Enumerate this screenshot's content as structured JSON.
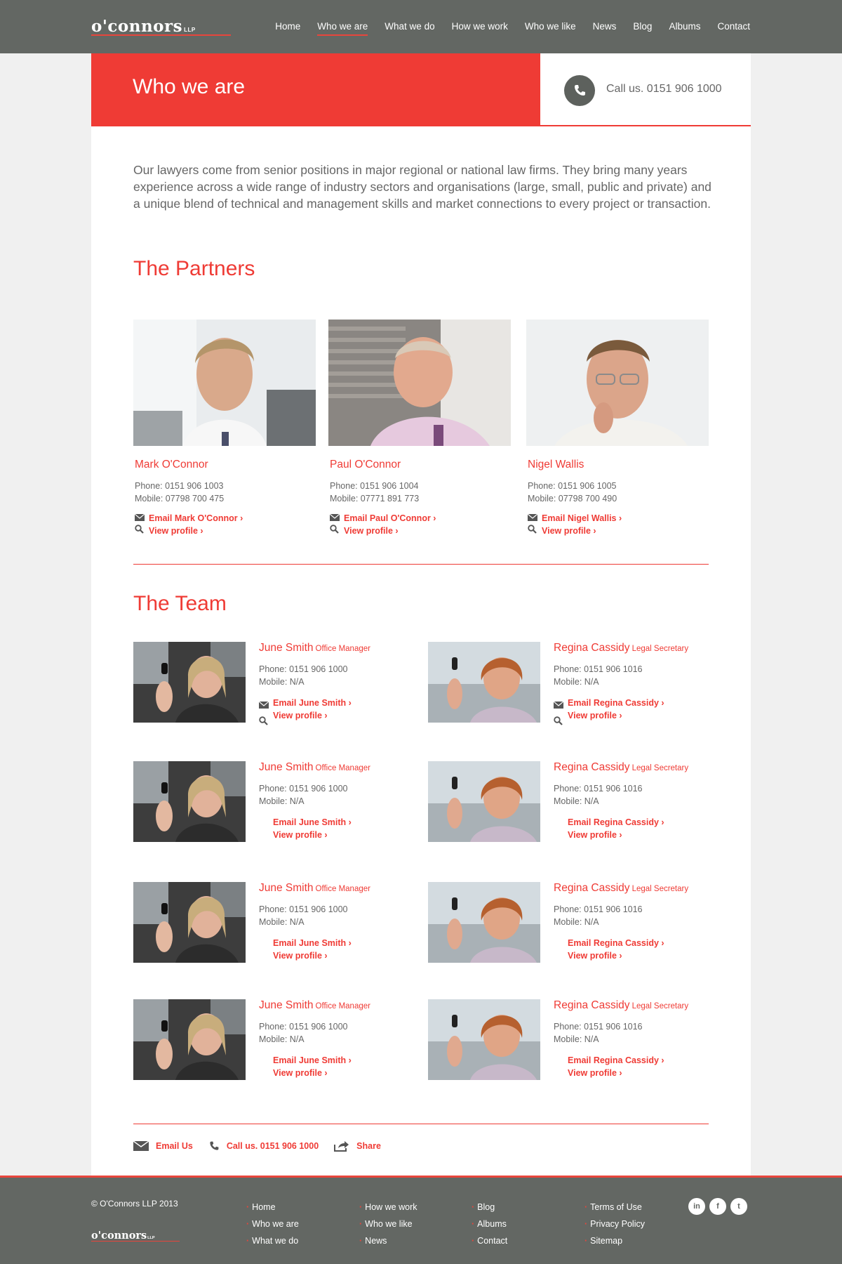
{
  "header": {
    "logo": "o'connors",
    "logo_suffix": "LLP",
    "nav": [
      "Home",
      "Who we are",
      "What we do",
      "How we work",
      "Who we like",
      "News",
      "Blog",
      "Albums",
      "Contact"
    ],
    "active_nav": "Who we are"
  },
  "hero": {
    "title": "Who we are",
    "call": "Call us. 0151 906 1000"
  },
  "intro": "Our lawyers come from senior positions in major regional or national law firms. They bring many years experience across a wide range of industry sectors and organisations (large, small, public and private) and a unique blend of technical and management skills and market connections to every project or transaction.",
  "partners_title": "The Partners",
  "partners": [
    {
      "name": "Mark O'Connor",
      "phone": "Phone: 0151 906 1003",
      "mobile": "Mobile: 07798 700 475",
      "email": "Email Mark O'Connor ›",
      "profile": "View profile ›"
    },
    {
      "name": "Paul O'Connor",
      "phone": "Phone: 0151 906 1004",
      "mobile": "Mobile: 07771 891 773",
      "email": "Email Paul O'Connor ›",
      "profile": "View profile ›"
    },
    {
      "name": "Nigel Wallis",
      "phone": "Phone: 0151 906 1005",
      "mobile": "Mobile: 07798 700 490",
      "email": "Email Nigel Wallis ›",
      "profile": "View profile ›"
    }
  ],
  "team_title": "The Team",
  "team": [
    {
      "name": "June Smith",
      "role": "Office Manager",
      "phone": "Phone: 0151 906 1000",
      "mobile": "Mobile: N/A",
      "email": "Email June Smith ›",
      "profile": "View profile ›"
    },
    {
      "name": "Regina Cassidy",
      "role": "Legal Secretary",
      "phone": "Phone: 0151 906 1016",
      "mobile": "Mobile: N/A",
      "email": "Email Regina Cassidy ›",
      "profile": "View profile ›"
    },
    {
      "name": "June Smith",
      "role": "Office Manager",
      "phone": "Phone: 0151 906 1000",
      "mobile": "Mobile: N/A",
      "email": "Email June Smith ›",
      "profile": "View profile ›"
    },
    {
      "name": "Regina Cassidy",
      "role": "Legal Secretary",
      "phone": "Phone: 0151 906 1016",
      "mobile": "Mobile: N/A",
      "email": "Email Regina Cassidy ›",
      "profile": "View profile ›"
    },
    {
      "name": "June Smith",
      "role": "Office Manager",
      "phone": "Phone: 0151 906 1000",
      "mobile": "Mobile: N/A",
      "email": "Email June Smith ›",
      "profile": "View profile ›"
    },
    {
      "name": "Regina Cassidy",
      "role": "Legal Secretary",
      "phone": "Phone: 0151 906 1016",
      "mobile": "Mobile: N/A",
      "email": "Email Regina Cassidy ›",
      "profile": "View profile ›"
    },
    {
      "name": "June Smith",
      "role": "Office Manager",
      "phone": "Phone: 0151 906 1000",
      "mobile": "Mobile: N/A",
      "email": "Email June Smith ›",
      "profile": "View profile ›"
    },
    {
      "name": "Regina Cassidy",
      "role": "Legal Secretary",
      "phone": "Phone: 0151 906 1016",
      "mobile": "Mobile: N/A",
      "email": "Email Regina Cassidy ›",
      "profile": "View profile ›"
    }
  ],
  "actions": {
    "email": "Email Us",
    "call": "Call us. 0151 906 1000",
    "share": "Share"
  },
  "footer": {
    "copyright": "© O'Connors LLP 2013",
    "logo": "o'connors",
    "logo_suffix": "LLP",
    "col1": [
      "Home",
      "Who we are",
      "What we do"
    ],
    "col2": [
      "How we work",
      "Who we like",
      "News"
    ],
    "col3": [
      "Blog",
      "Albums",
      "Contact"
    ],
    "col4": [
      "Terms of Use",
      "Privacy Policy",
      "Sitemap"
    ],
    "social": [
      "in",
      "f",
      "t"
    ]
  },
  "colors": {
    "brand_red": "#ef3b35",
    "header_grey": "#636763"
  }
}
